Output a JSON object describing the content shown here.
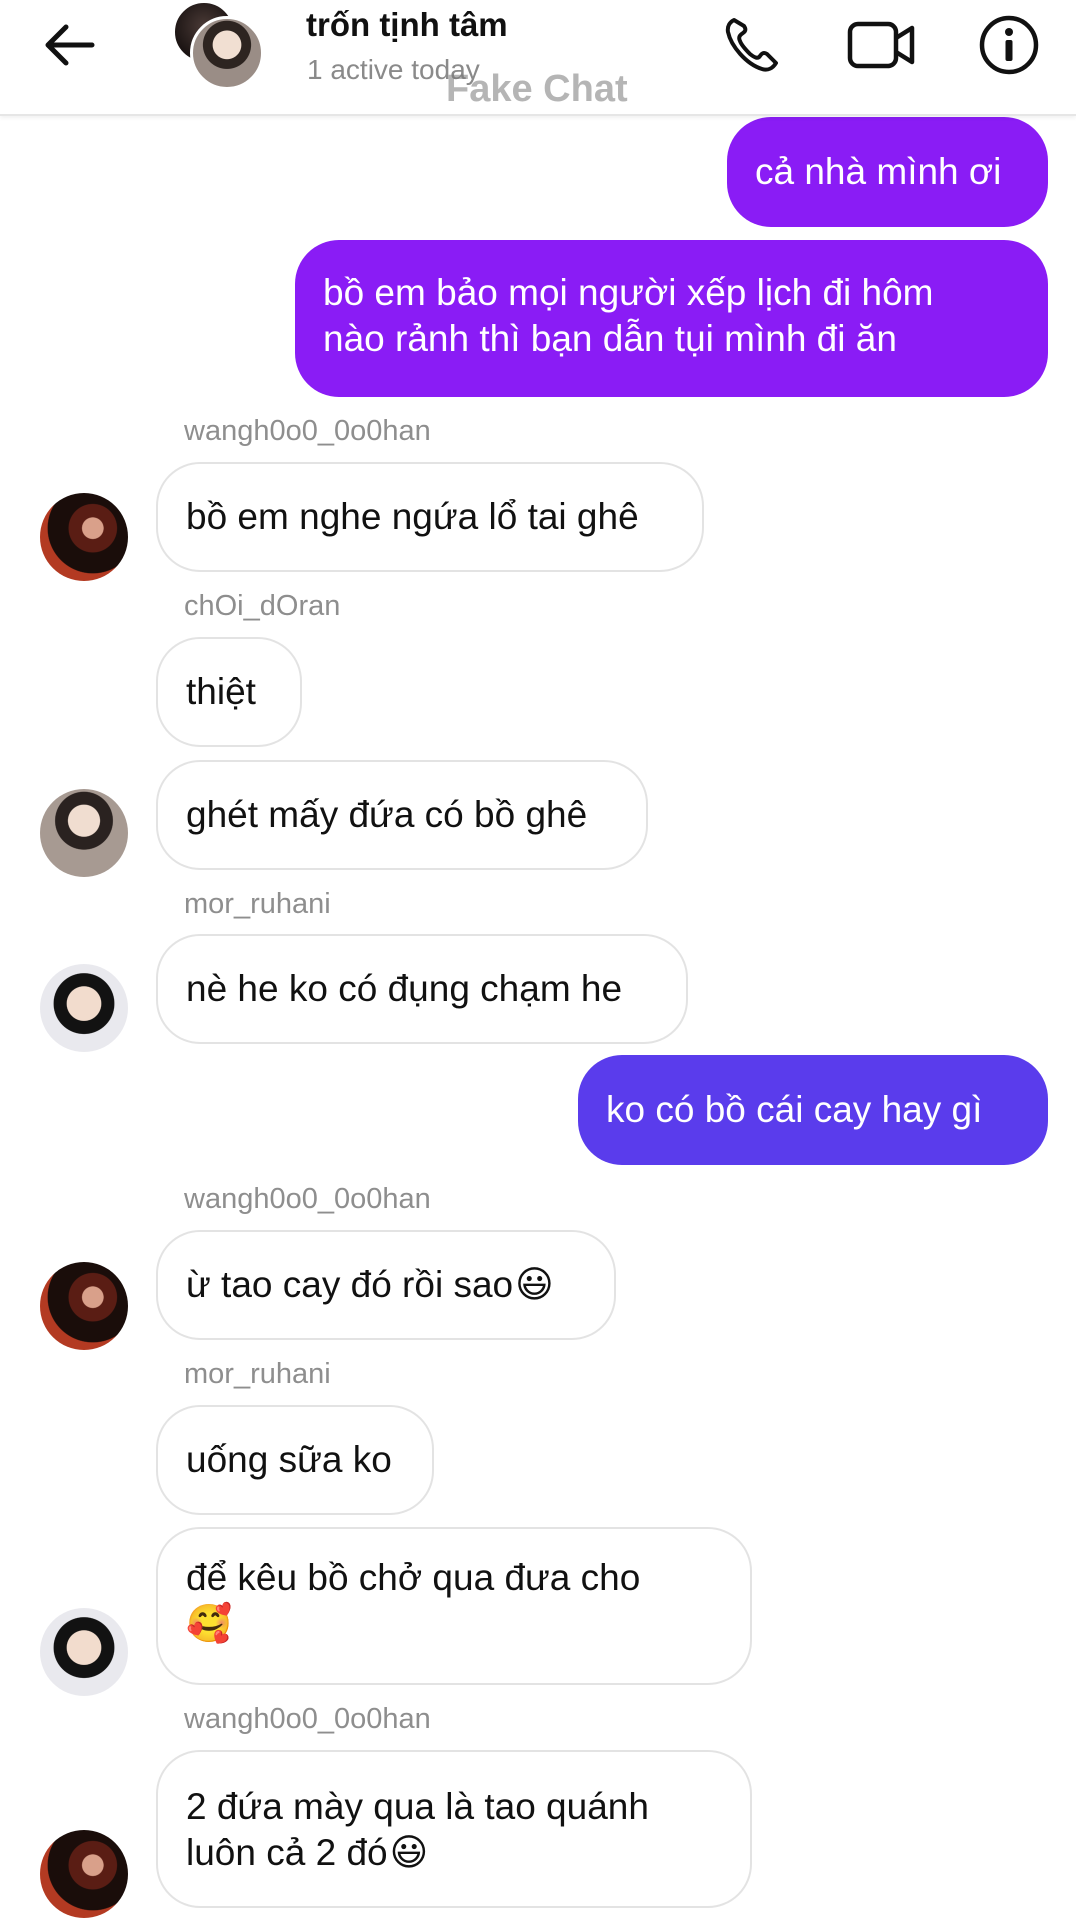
{
  "header": {
    "title": "trốn tịnh tâm",
    "status": "1 active today",
    "watermark": "Fake Chat"
  },
  "colors": {
    "outgoing_purple": "#8a1cf5",
    "outgoing_indigo": "#5a3cec",
    "incoming_bg": "#ffffff",
    "sender_name": "#8e8e8e"
  },
  "messages": [
    {
      "id": "m1",
      "direction": "out",
      "text": "cả nhà mình ơi"
    },
    {
      "id": "m2",
      "direction": "out",
      "lines": [
        "bồ em bảo mọi người xếp lịch đi hôm",
        "nào rảnh thì bạn dẫn tụi mình đi ăn"
      ]
    },
    {
      "id": "m3",
      "direction": "in",
      "sender": "wangh0o0_0o0han",
      "text": "bồ em nghe ngứa lổ tai ghê"
    },
    {
      "id": "m4",
      "direction": "in",
      "sender": "chOi_dOran",
      "text": "thiệt"
    },
    {
      "id": "m5",
      "direction": "in",
      "text": "ghét mấy đứa có bồ ghê"
    },
    {
      "id": "m6",
      "direction": "in",
      "sender": "mor_ruhani",
      "text": "nè he ko có đụng chạm he"
    },
    {
      "id": "m7",
      "direction": "out",
      "text": "ko có bồ cái cay hay gì"
    },
    {
      "id": "m8",
      "direction": "in",
      "sender": "wangh0o0_0o0han",
      "text": "ừ tao cay đó rồi sao",
      "emoji": "😃"
    },
    {
      "id": "m9",
      "direction": "in",
      "sender": "mor_ruhani",
      "text": "uống sữa ko"
    },
    {
      "id": "m10",
      "direction": "in",
      "text": "để kêu bồ chở qua đưa cho",
      "emoji": "🥰"
    },
    {
      "id": "m11",
      "direction": "in",
      "sender": "wangh0o0_0o0han",
      "lines": [
        "2 đứa mày qua là tao quánh",
        "luôn cả 2 đó"
      ],
      "emoji": "😃"
    }
  ]
}
